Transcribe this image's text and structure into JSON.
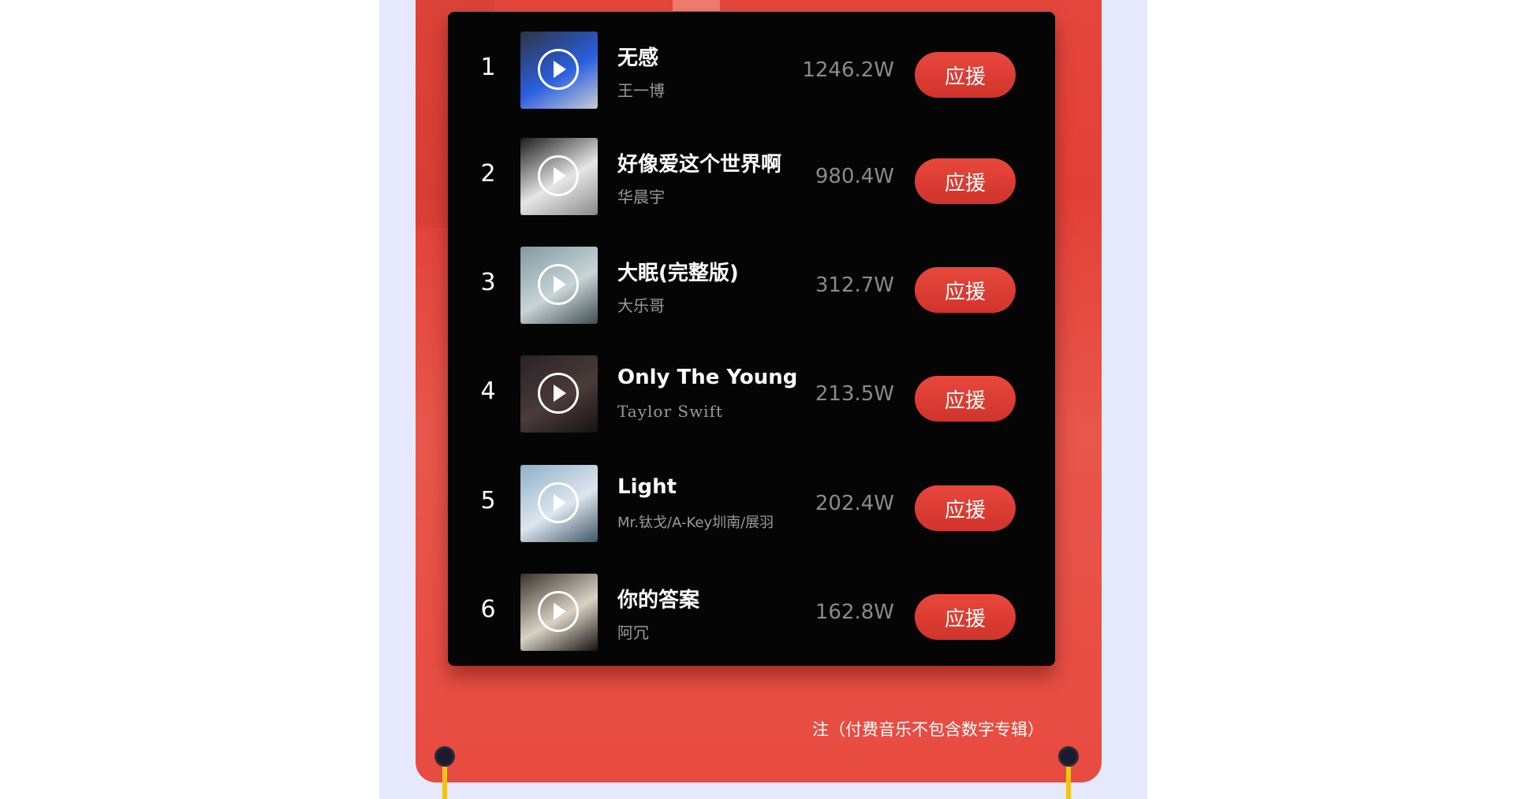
{
  "songs": [
    {
      "rank": "1",
      "title": "无感",
      "artist": "王一博",
      "count": "1246.2W",
      "button": "应援",
      "cover_colors": [
        "#2f3442",
        "#2a5fe0",
        "#c9ccd3"
      ]
    },
    {
      "rank": "2",
      "title": "好像爱这个世界啊",
      "artist": "华晨宇",
      "count": "980.4W",
      "button": "应援",
      "cover_colors": [
        "#1d1d1f",
        "#e6e6e6",
        "#8a8a8a"
      ]
    },
    {
      "rank": "3",
      "title": "大眠(完整版)",
      "artist": "大乐哥",
      "count": "312.7W",
      "button": "应援",
      "cover_colors": [
        "#7f9aa2",
        "#c8d4d6",
        "#3f4e52"
      ]
    },
    {
      "rank": "4",
      "title": "Only The Young",
      "artist": "Taylor Swift",
      "count": "213.5W",
      "button": "应援",
      "cover_colors": [
        "#2a2226",
        "#4b3b3a",
        "#151214"
      ]
    },
    {
      "rank": "5",
      "title": "Light",
      "artist": "Mr.钛戈/A-Key圳南/展羽",
      "count": "202.4W",
      "button": "应援",
      "cover_colors": [
        "#8fb0c8",
        "#dce6ee",
        "#3e5668"
      ]
    },
    {
      "rank": "6",
      "title": "你的答案",
      "artist": "阿冗",
      "count": "162.8W",
      "button": "应援",
      "cover_colors": [
        "#3a342c",
        "#d9d2c4",
        "#161412"
      ]
    }
  ],
  "note": "注（付费音乐不包含数字专辑）",
  "colors": {
    "panel": "#e4463c",
    "card": "#050505",
    "button": "#df3e34",
    "background": "#e6e9fb"
  }
}
